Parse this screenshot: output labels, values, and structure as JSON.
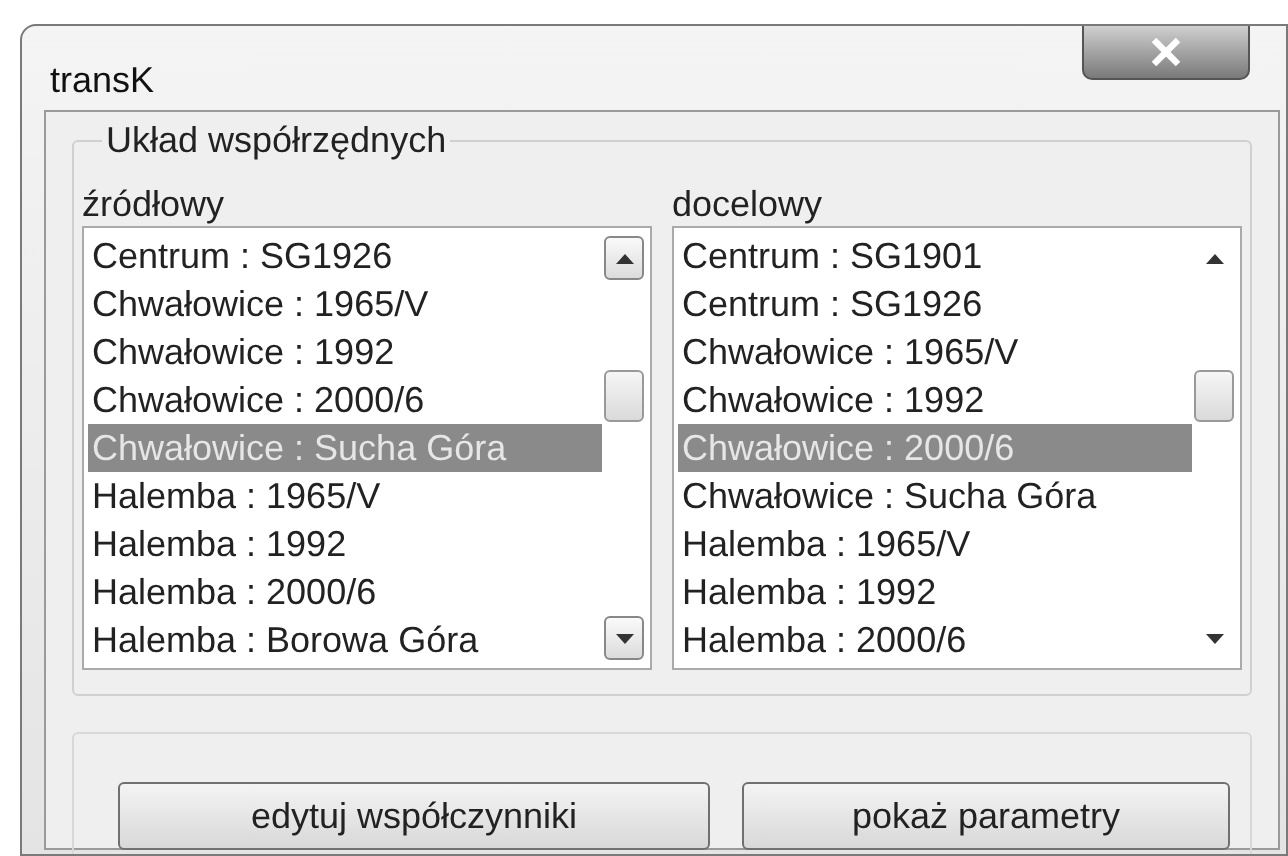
{
  "window": {
    "title": "transK"
  },
  "group": {
    "title": "Układ współrzędnych"
  },
  "lists": [
    {
      "label": "źródłowy",
      "scrollbar_hovered": true,
      "items": [
        {
          "text": "Centrum : SG1926",
          "selected": false
        },
        {
          "text": "Chwałowice : 1965/V",
          "selected": false
        },
        {
          "text": "Chwałowice : 1992",
          "selected": false
        },
        {
          "text": "Chwałowice : 2000/6",
          "selected": false
        },
        {
          "text": "Chwałowice : Sucha Góra",
          "selected": true
        },
        {
          "text": "Halemba : 1965/V",
          "selected": false
        },
        {
          "text": "Halemba : 1992",
          "selected": false
        },
        {
          "text": "Halemba : 2000/6",
          "selected": false
        },
        {
          "text": "Halemba : Borowa Góra",
          "selected": false
        }
      ]
    },
    {
      "label": "docelowy",
      "scrollbar_hovered": false,
      "items": [
        {
          "text": "Centrum : SG1901",
          "selected": false
        },
        {
          "text": "Centrum : SG1926",
          "selected": false
        },
        {
          "text": "Chwałowice : 1965/V",
          "selected": false
        },
        {
          "text": "Chwałowice : 1992",
          "selected": false
        },
        {
          "text": "Chwałowice : 2000/6",
          "selected": true
        },
        {
          "text": "Chwałowice : Sucha Góra",
          "selected": false
        },
        {
          "text": "Halemba : 1965/V",
          "selected": false
        },
        {
          "text": "Halemba : 1992",
          "selected": false
        },
        {
          "text": "Halemba : 2000/6",
          "selected": false
        }
      ]
    }
  ],
  "buttons": [
    "edytuj współczynniki",
    "pokaż parametry"
  ]
}
